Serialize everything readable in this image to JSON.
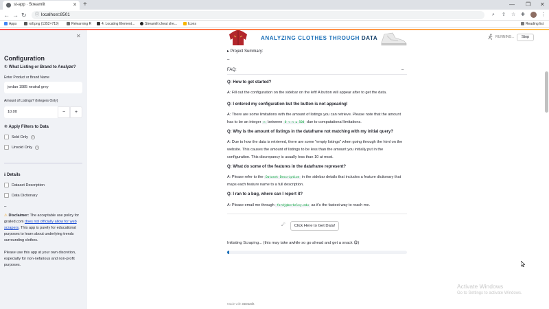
{
  "browser": {
    "tab_title": "st-app · Streamlit",
    "url": "localhost:8501",
    "new_tab": "+",
    "bookmarks": [
      {
        "label": "Apps",
        "color": "#4285f4"
      },
      {
        "label": "roll.png (1352×719)",
        "color": "#555555"
      },
      {
        "label": "Relearning R",
        "color": "#6a6a6a"
      },
      {
        "label": "4. Locating Element...",
        "color": "#333333"
      },
      {
        "label": "Streamlit cheat she...",
        "color": "#222222"
      },
      {
        "label": "Icons",
        "color": "#f7b500"
      }
    ],
    "reading_list": "Reading list"
  },
  "sidebar": {
    "title": "Configuration",
    "section1": "① What Listing or Brand to Analyze?",
    "product_label": "Enter Product or Brand Name",
    "product_value": "jordan 1985 neutral grey",
    "listings_label": "Amount of Listings? (Integers Only)",
    "listings_value": "10.00",
    "minus": "−",
    "plus": "+",
    "section2": "② Apply Filters to Data",
    "sold_only": "Sold Only",
    "unsold_only": "Unsold Only",
    "section3": "ℹ Details",
    "dataset_description": "Dataset Description",
    "data_dictionary": "Data Dictionary",
    "dash": "–",
    "disclaimer_bold": "Disclaimer:",
    "disclaimer_1": " The acceptable use policy for grailed.com ",
    "disclaimer_link": "does not officially allow for web scrapers",
    "disclaimer_2": ". This app is purely for educational purposes to learn about underlying trends surrounding clothes.",
    "disclaimer_3": "Please use this app at your own discretion, especially for non-nefarious and non-profit purposes."
  },
  "header": {
    "title_part": "ANALYZING CLOTHES THROUGH ",
    "title_bold": "DATA",
    "running": "RUNNING...",
    "stop": "Stop"
  },
  "main": {
    "project_summary": "▸ Project Summary:",
    "dash": "–",
    "faq": "FAQ:",
    "faq_toggle": "–",
    "q1": "Q: How to get started?",
    "a1": "Fill out the configuration on the sidebar on the left! A button will appear after to get the data.",
    "q2": "Q: I entered my configuration but the button is not appearing!",
    "a2_1": "There are some limitations with the amount of listings you can retrieve. Please note that the amount has to be an integer",
    "a2_code1": "n",
    "a2_between": "between",
    "a2_code2": "0 < n ≤ 500",
    "a2_2": "due to computational limitations.",
    "q3": "Q: Why is the amount of listings in the dataframe not matching with my initial query?",
    "a3": "Due to how the data is retrieved, there are some \"empty listings\" when going through the html on the website. This causes the amount of listings to be less than the amount you initially put in the configuration. This discrepancy is usually less than 10 at most.",
    "q4": "Q: What do some of the features in the dataframe represent?",
    "a4_1": "Please refer to the",
    "a4_code": "Dataset Description",
    "a4_2": "in the sidebar details that includes a feature dictionary that maps each feature name to a full description.",
    "q5": "Q: I ran to a bug, where can I report it?",
    "a5_1": "Please email me through",
    "a5_code": "fordj@berkeley.edu",
    "a5_2": "as it's the fastest way to reach me.",
    "a_prefix": "A:",
    "get_data": "Click Here to Get Data!",
    "status": "Initiating Scraping... (this may take awhile so go ahead and get a snack 😋)",
    "progress": 0.01
  },
  "overlay": {
    "activate_title": "Activate Windows",
    "activate_sub": "Go to Settings to activate Windows."
  },
  "footer": {
    "made_with": "Made with ",
    "brand": "Streamlit"
  },
  "colors": {
    "accent": "#ff4b4b",
    "title_blue": "#1b6fb7",
    "link": "#1a4bd1",
    "code_green": "#09ab3b"
  }
}
